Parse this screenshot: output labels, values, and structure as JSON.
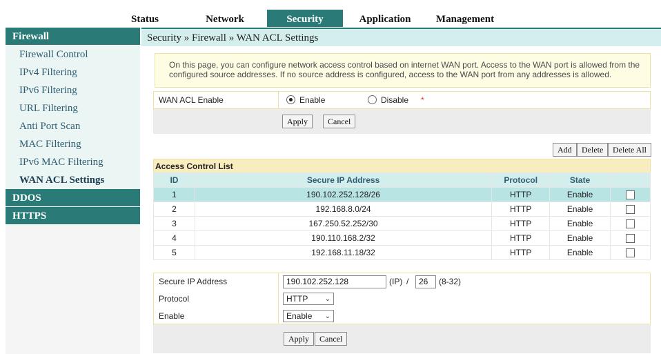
{
  "nav": {
    "tabs": [
      {
        "label": "Status"
      },
      {
        "label": "Network"
      },
      {
        "label": "Security"
      },
      {
        "label": "Application"
      },
      {
        "label": "Management"
      }
    ]
  },
  "sidebar": {
    "firewall": "Firewall",
    "items": [
      {
        "label": "Firewall Control"
      },
      {
        "label": "IPv4 Filtering"
      },
      {
        "label": "IPv6 Filtering"
      },
      {
        "label": "URL Filtering"
      },
      {
        "label": "Anti Port Scan"
      },
      {
        "label": "MAC Filtering"
      },
      {
        "label": "IPv6 MAC Filtering"
      },
      {
        "label": "WAN ACL Settings"
      }
    ],
    "ddos": "DDOS",
    "https": "HTTPS"
  },
  "breadcrumb": "Security » Firewall » WAN ACL Settings",
  "info": "On this page, you can configure network access control based on internet WAN port. Access to the WAN port is allowed from the configured source addresses. If no source address is configured, access to the WAN port from any addresses is allowed.",
  "wan_acl": {
    "label": "WAN ACL Enable",
    "enable_label": "Enable",
    "disable_label": "Disable",
    "required_mark": "*",
    "selected": "Enable",
    "apply": "Apply",
    "cancel": "Cancel"
  },
  "table_buttons": {
    "add": "Add",
    "delete": "Delete",
    "delete_all": "Delete All"
  },
  "acl": {
    "title": "Access Control List",
    "headers": {
      "id": "ID",
      "ip": "Secure IP Address",
      "protocol": "Protocol",
      "state": "State"
    },
    "rows": [
      {
        "id": "1",
        "ip": "190.102.252.128/26",
        "protocol": "HTTP",
        "state": "Enable",
        "selected": true
      },
      {
        "id": "2",
        "ip": "192.168.8.0/24",
        "protocol": "HTTP",
        "state": "Enable"
      },
      {
        "id": "3",
        "ip": "167.250.52.252/30",
        "protocol": "HTTP",
        "state": "Enable"
      },
      {
        "id": "4",
        "ip": "190.110.168.2/32",
        "protocol": "HTTP",
        "state": "Enable"
      },
      {
        "id": "5",
        "ip": "192.168.11.18/32",
        "protocol": "HTTP",
        "state": "Enable"
      }
    ]
  },
  "form": {
    "ip_label": "Secure IP Address",
    "ip_value": "190.102.252.128",
    "ip_suffix": "(IP)",
    "slash": "/",
    "mask_value": "26",
    "mask_range": "(8-32)",
    "protocol_label": "Protocol",
    "protocol_value": "HTTP",
    "enable_label": "Enable",
    "enable_value": "Enable",
    "apply": "Apply",
    "cancel": "Cancel"
  },
  "colors": {
    "accent": "#2a7a77",
    "header_light": "#d4eeed",
    "selected_row": "#b8e4e4",
    "info_bg": "#fefce3"
  }
}
